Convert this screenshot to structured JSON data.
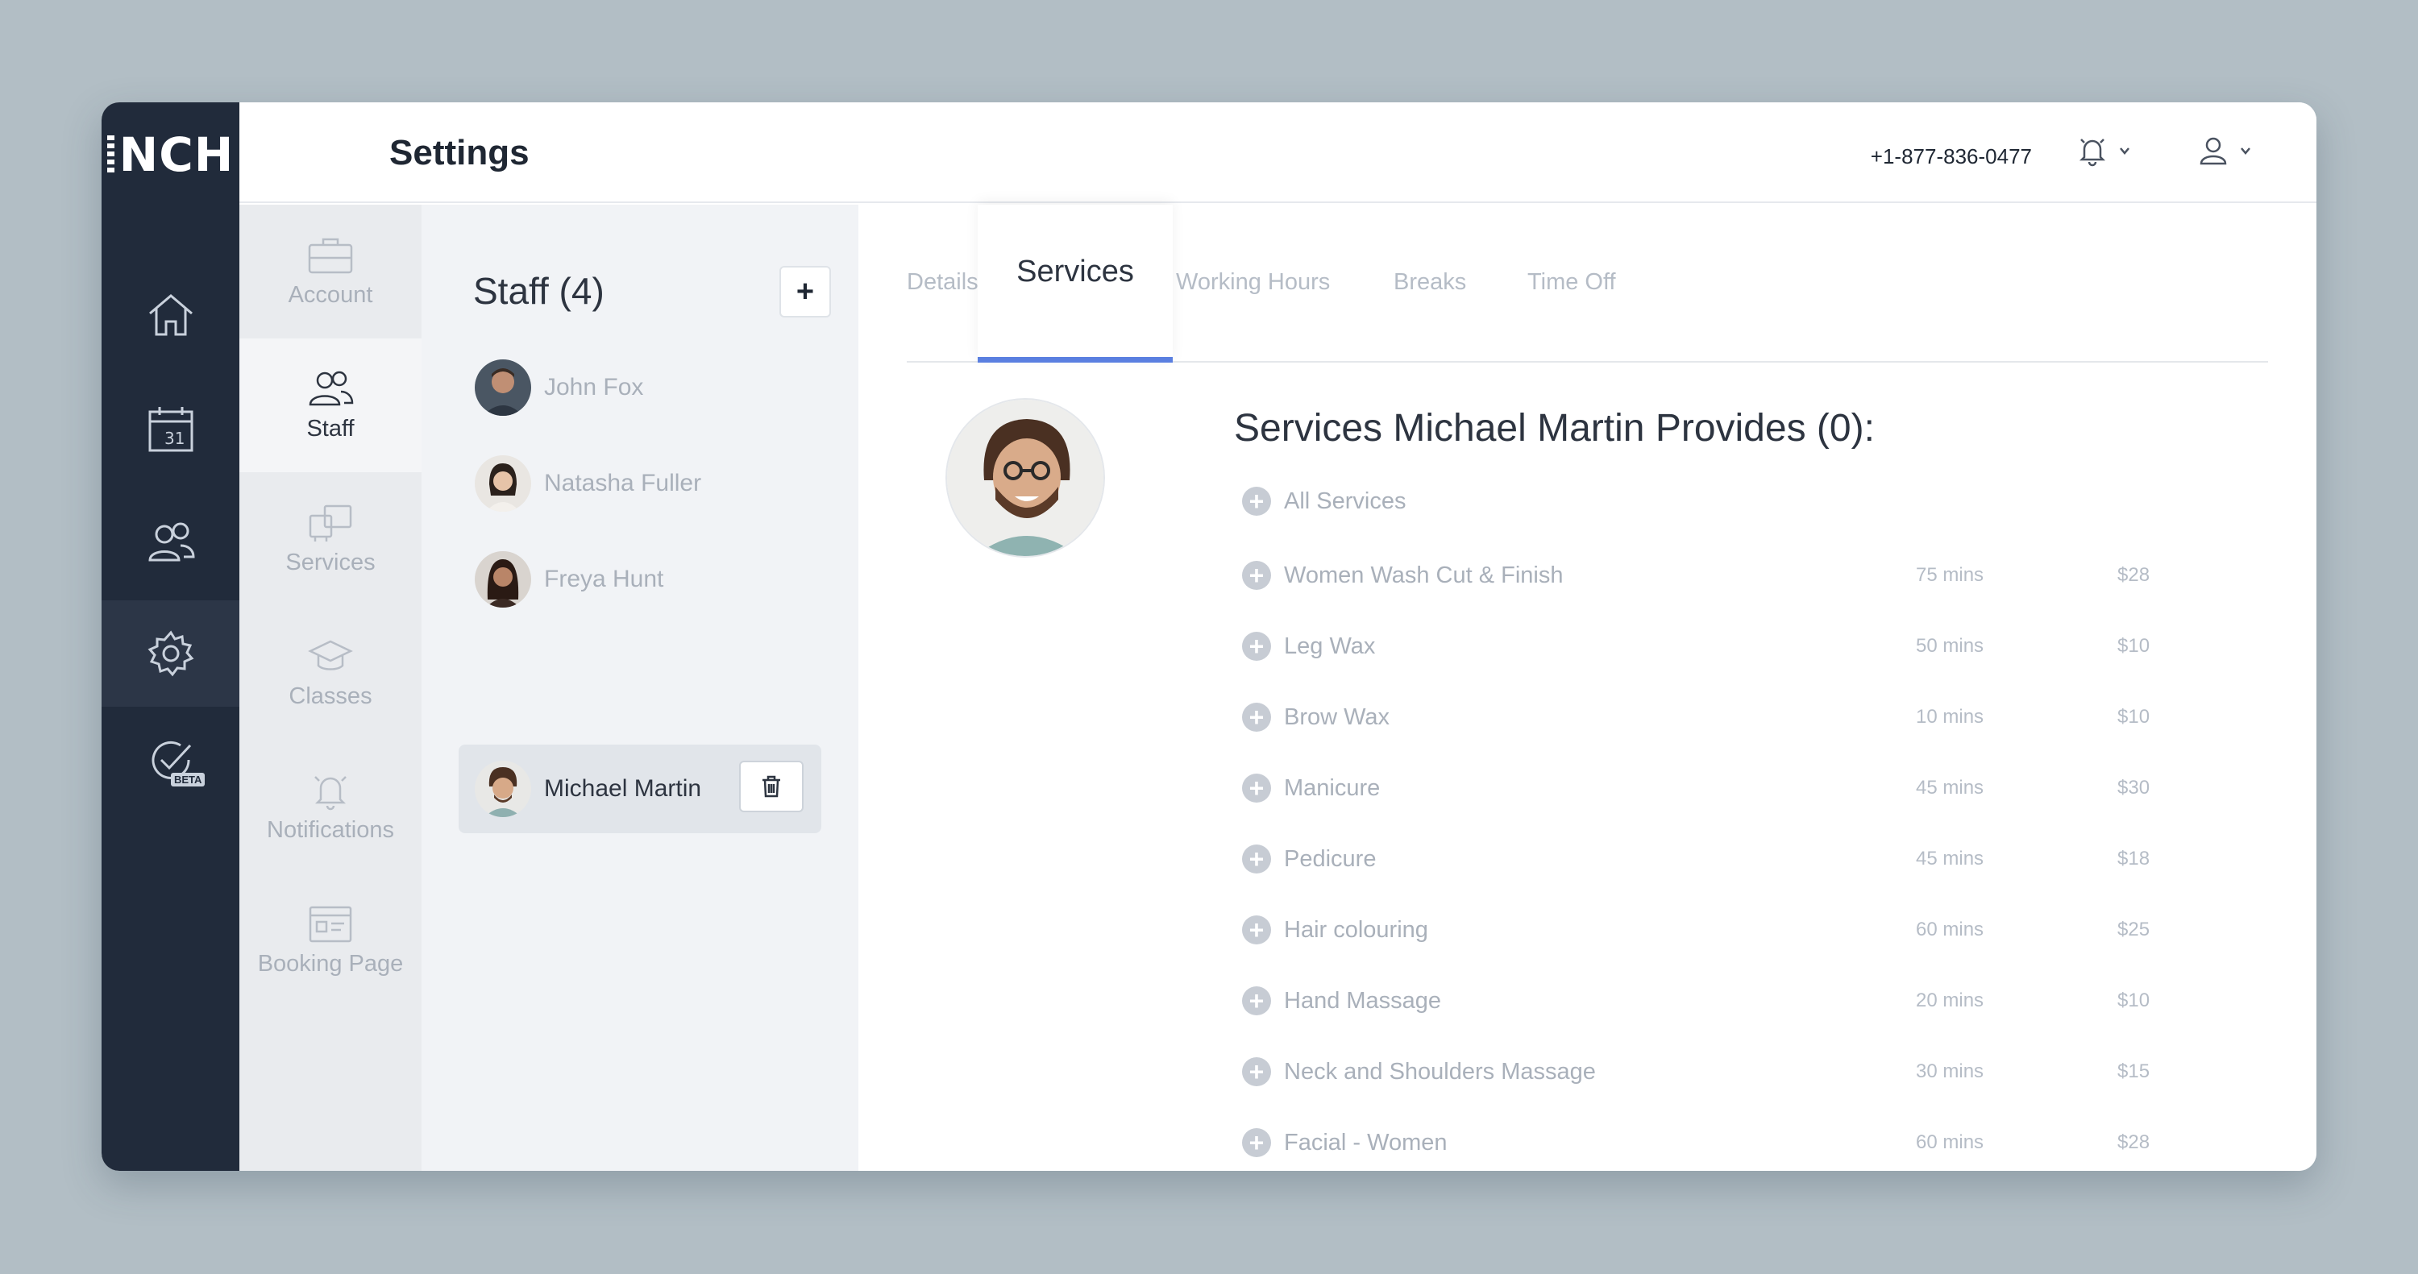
{
  "app": {
    "logo_text": "NCH"
  },
  "header": {
    "title": "Settings",
    "phone": "+1-877-836-0477"
  },
  "rail": [
    {
      "name": "home-icon"
    },
    {
      "name": "calendar-icon",
      "text": "31"
    },
    {
      "name": "people-icon"
    },
    {
      "name": "settings-gear-icon",
      "active": true
    },
    {
      "name": "check-beta-icon",
      "badge": "BETA"
    }
  ],
  "settings_nav": [
    {
      "label": "Account",
      "icon": "briefcase-icon"
    },
    {
      "label": "Staff",
      "icon": "staff-icon",
      "active": true
    },
    {
      "label": "Services",
      "icon": "services-icon"
    },
    {
      "label": "Classes",
      "icon": "graduation-cap-icon"
    },
    {
      "label": "Notifications",
      "icon": "bell-icon"
    },
    {
      "label": "Booking Page",
      "icon": "booking-page-icon"
    }
  ],
  "staff": {
    "title": "Staff (4)",
    "add_label": "+",
    "members": [
      {
        "name": "John Fox"
      },
      {
        "name": "Natasha Fuller"
      },
      {
        "name": "Freya Hunt"
      },
      {
        "name": "Michael Martin",
        "selected": true
      }
    ]
  },
  "tabs": [
    {
      "label": "Details"
    },
    {
      "label": "Services",
      "active": true
    },
    {
      "label": "Working Hours"
    },
    {
      "label": "Breaks"
    },
    {
      "label": "Time Off"
    }
  ],
  "services": {
    "title": "Services Michael Martin Provides (0):",
    "all_label": "All Services",
    "items": [
      {
        "name": "Women Wash Cut & Finish",
        "duration": "75 mins",
        "price": "$28"
      },
      {
        "name": "Leg Wax",
        "duration": "50 mins",
        "price": "$10"
      },
      {
        "name": "Brow Wax",
        "duration": "10 mins",
        "price": "$10"
      },
      {
        "name": "Manicure",
        "duration": "45 mins",
        "price": "$30"
      },
      {
        "name": "Pedicure",
        "duration": "45 mins",
        "price": "$18"
      },
      {
        "name": "Hair colouring",
        "duration": "60 mins",
        "price": "$25"
      },
      {
        "name": "Hand Massage",
        "duration": "20 mins",
        "price": "$10"
      },
      {
        "name": "Neck and Shoulders Massage",
        "duration": "30 mins",
        "price": "$15"
      },
      {
        "name": "Facial - Women",
        "duration": "60 mins",
        "price": "$28"
      }
    ]
  },
  "colors": {
    "rail": "#212b3b",
    "accent": "#5a7fe0",
    "background": "#b2bec5"
  }
}
